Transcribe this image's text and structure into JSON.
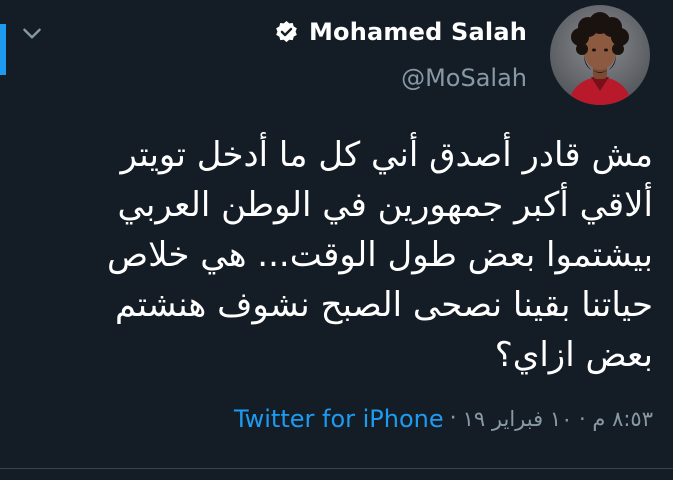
{
  "author": {
    "name": "Mohamed Salah",
    "handle": "@MoSalah",
    "verified": true
  },
  "tweet": {
    "lines": [
      "مش قادر أصدق أني كل ما أدخل تويتر",
      "ألاقي أكبر جمهورين في الوطن العربي",
      "بيشتموا بعض طول الوقت... هي خلاص",
      "حياتنا بقينا نصحى الصبح نشوف هنشتم",
      "بعض ازاي؟"
    ]
  },
  "meta": {
    "timestamp": "٨:٥٣ م · ١٠ فبراير ١٩",
    "separator": "·",
    "source": "Twitter for iPhone"
  },
  "icons": {
    "collapse": "chevron-down-icon",
    "verified": "verified-badge-icon"
  },
  "colors": {
    "background": "#141d26",
    "text": "#ffffff",
    "muted": "#8899a6",
    "accent": "#1d9bf0"
  }
}
